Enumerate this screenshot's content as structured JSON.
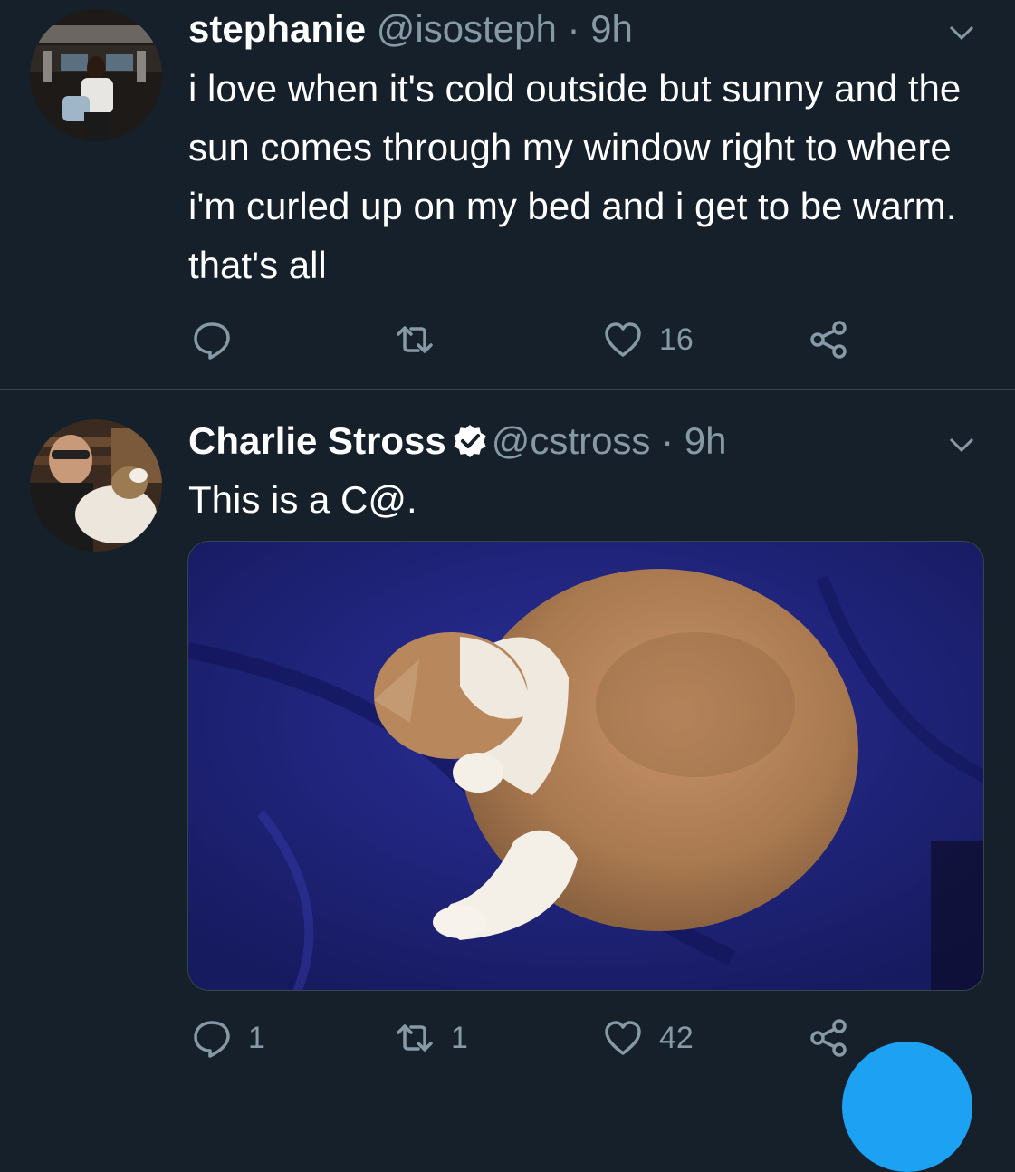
{
  "colors": {
    "background": "#15202b",
    "secondary_text": "#8899a6",
    "divider": "#38444d",
    "accent": "#1da1f2"
  },
  "tweets": [
    {
      "display_name": "stephanie",
      "handle": "@isosteph",
      "separator": "·",
      "time": "9h",
      "text": "i love when it's cold outside but sunny and the sun comes through my window right to where i'm curled up on my bed and i get to be warm. that's all",
      "verified": false,
      "actions": {
        "reply": "",
        "retweet": "",
        "like": "16"
      }
    },
    {
      "display_name": "Charlie Stross",
      "handle": "@cstross",
      "separator": "·",
      "time": "9h",
      "text": "This is a C@.",
      "verified": true,
      "media": "photo of an orange and white cat curled up asleep on a blue blanket",
      "actions": {
        "reply": "1",
        "retweet": "1",
        "like": "42"
      }
    }
  ],
  "icons": [
    "reply-icon",
    "retweet-icon",
    "like-icon",
    "share-icon",
    "caret-down-icon",
    "verified-badge-icon"
  ]
}
